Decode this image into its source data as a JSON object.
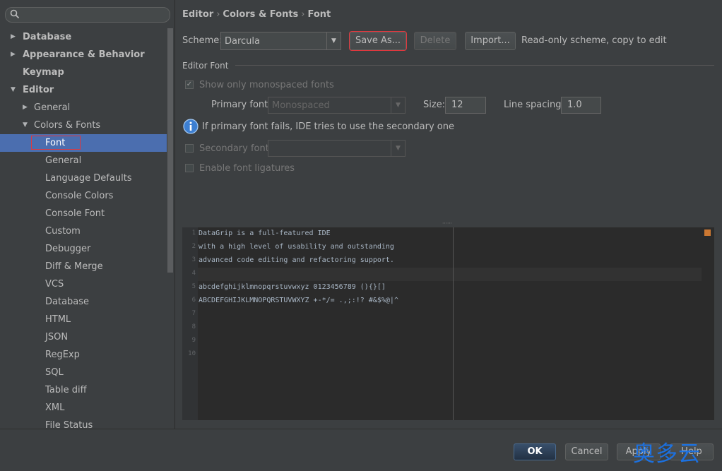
{
  "sidebar": {
    "search": {
      "placeholder": ""
    },
    "tree": [
      {
        "label": "Database",
        "arrow": "▶",
        "indent": 0,
        "bold": true
      },
      {
        "label": "Appearance & Behavior",
        "arrow": "▶",
        "indent": 0,
        "bold": true
      },
      {
        "label": "Keymap",
        "arrow": "",
        "indent": 0,
        "bold": true
      },
      {
        "label": "Editor",
        "arrow": "▼",
        "indent": 0,
        "bold": true
      },
      {
        "label": "General",
        "arrow": "▶",
        "indent": 1,
        "bold": false
      },
      {
        "label": "Colors & Fonts",
        "arrow": "▼",
        "indent": 1,
        "bold": false
      },
      {
        "label": "Font",
        "arrow": "",
        "indent": 2,
        "bold": false,
        "selected": true
      },
      {
        "label": "General",
        "arrow": "",
        "indent": 2,
        "bold": false
      },
      {
        "label": "Language Defaults",
        "arrow": "",
        "indent": 2,
        "bold": false
      },
      {
        "label": "Console Colors",
        "arrow": "",
        "indent": 2,
        "bold": false
      },
      {
        "label": "Console Font",
        "arrow": "",
        "indent": 2,
        "bold": false
      },
      {
        "label": "Custom",
        "arrow": "",
        "indent": 2,
        "bold": false
      },
      {
        "label": "Debugger",
        "arrow": "",
        "indent": 2,
        "bold": false
      },
      {
        "label": "Diff & Merge",
        "arrow": "",
        "indent": 2,
        "bold": false
      },
      {
        "label": "VCS",
        "arrow": "",
        "indent": 2,
        "bold": false
      },
      {
        "label": "Database",
        "arrow": "",
        "indent": 2,
        "bold": false
      },
      {
        "label": "HTML",
        "arrow": "",
        "indent": 2,
        "bold": false
      },
      {
        "label": "JSON",
        "arrow": "",
        "indent": 2,
        "bold": false
      },
      {
        "label": "RegExp",
        "arrow": "",
        "indent": 2,
        "bold": false
      },
      {
        "label": "SQL",
        "arrow": "",
        "indent": 2,
        "bold": false
      },
      {
        "label": "Table diff",
        "arrow": "",
        "indent": 2,
        "bold": false
      },
      {
        "label": "XML",
        "arrow": "",
        "indent": 2,
        "bold": false
      },
      {
        "label": "File Status",
        "arrow": "",
        "indent": 2,
        "bold": false
      }
    ]
  },
  "breadcrumb": [
    "Editor",
    "Colors & Fonts",
    "Font"
  ],
  "scheme": {
    "label": "Scheme:",
    "value": "Darcula",
    "save_as": "Save As...",
    "delete": "Delete",
    "import": "Import...",
    "note": "Read-only scheme, copy to edit"
  },
  "editor_font": {
    "section_title": "Editor Font",
    "monospaced_label": "Show only monospaced fonts",
    "monospaced_checked": true,
    "primary_label": "Primary font:",
    "primary_value": "Monospaced",
    "size_label": "Size:",
    "size_value": "12",
    "spacing_label": "Line spacing:",
    "spacing_value": "1.0",
    "info_text": "If primary font fails, IDE tries to use the secondary one",
    "secondary_label": "Secondary font:",
    "secondary_value": "",
    "ligatures_label": "Enable font ligatures",
    "ligatures_checked": false
  },
  "preview": {
    "lines": [
      {
        "num": "1",
        "text": "DataGrip is a full-featured IDE"
      },
      {
        "num": "2",
        "text": "with a high level of usability and outstanding"
      },
      {
        "num": "3",
        "text": "advanced code editing and refactoring support."
      },
      {
        "num": "4",
        "text": ""
      },
      {
        "num": "5",
        "text": "abcdefghijklmnopqrstuvwxyz 0123456789 (){}[]"
      },
      {
        "num": "6",
        "text": "ABCDEFGHIJKLMNOPQRSTUVWXYZ +-*/= .,;:!? #&$%@|^"
      },
      {
        "num": "7",
        "text": ""
      },
      {
        "num": "8",
        "text": ""
      },
      {
        "num": "9",
        "text": ""
      },
      {
        "num": "10",
        "text": ""
      }
    ]
  },
  "footer": {
    "ok": "OK",
    "cancel": "Cancel",
    "apply": "Apply",
    "help": "Help"
  },
  "watermark": "奥多云",
  "colors": {
    "background": "#3c3f41",
    "selection": "#4b6eaf",
    "highlight_box": "#e0383e",
    "editor_bg": "#2b2b2b",
    "watermark": "#1a73e8"
  }
}
